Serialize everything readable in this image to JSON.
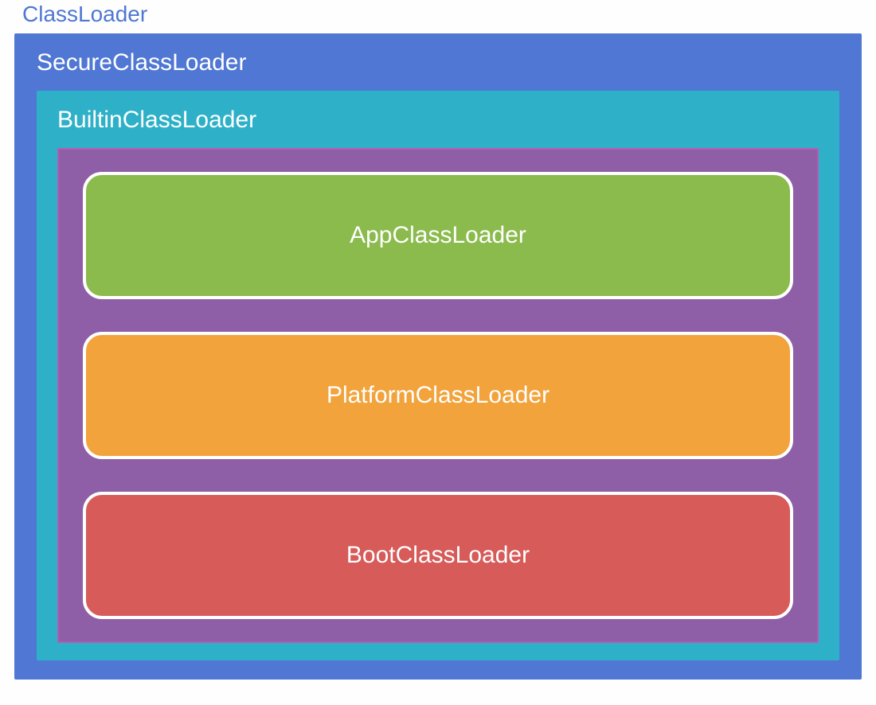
{
  "outer": {
    "label": "ClassLoader"
  },
  "secure": {
    "label": "SecureClassLoader"
  },
  "builtin": {
    "label": "BuiltinClassLoader"
  },
  "loaders": {
    "app": "AppClassLoader",
    "platform": "PlatformClassLoader",
    "boot": "BootClassLoader"
  }
}
